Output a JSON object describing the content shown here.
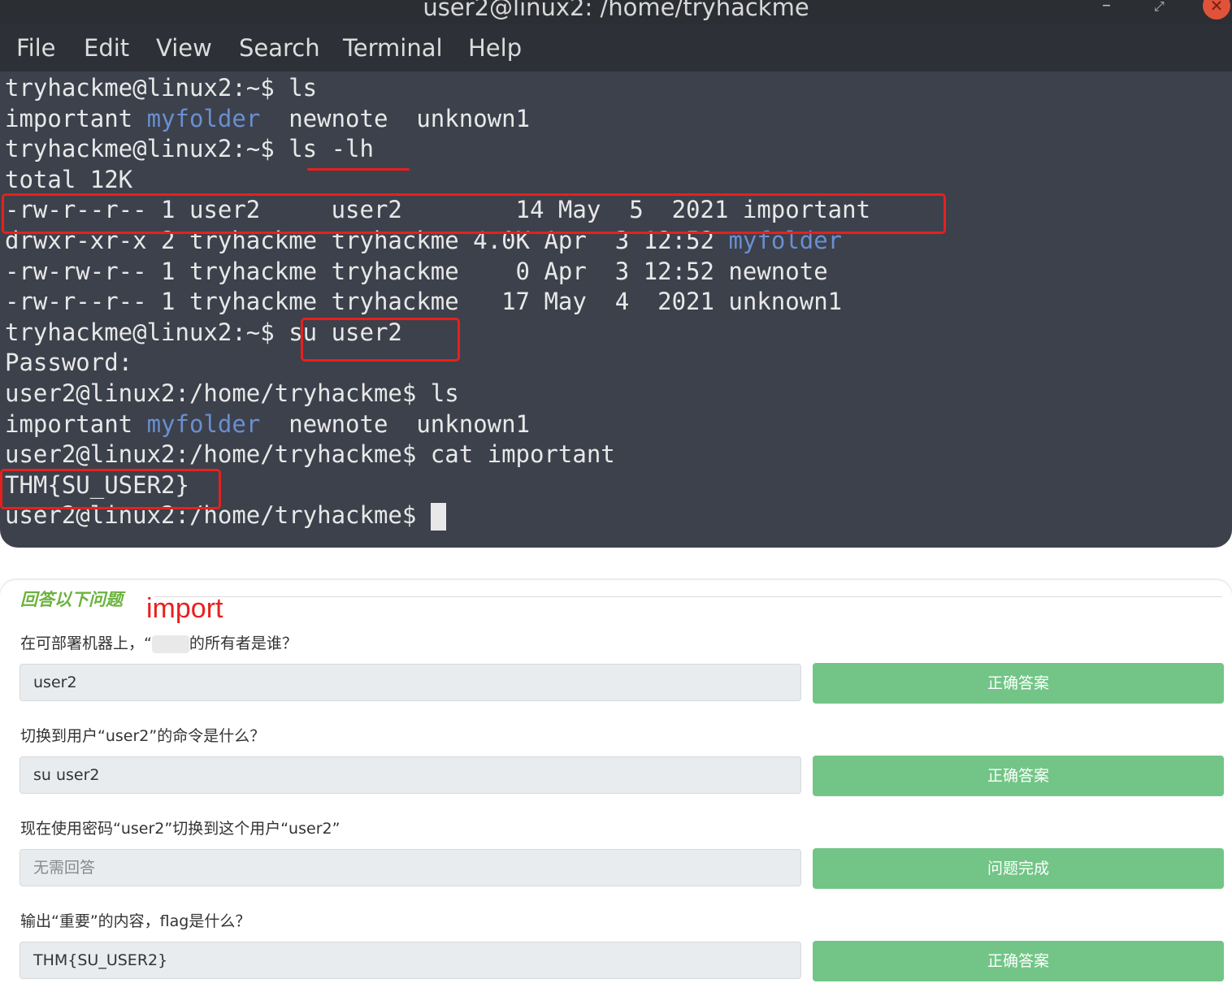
{
  "window": {
    "title": "user2@linux2: /home/tryhackme",
    "minimize_icon": "minimize-icon",
    "maximize_icon": "maximize-icon",
    "close_icon": "close-icon"
  },
  "menu": [
    "File",
    "Edit",
    "View",
    "Search",
    "Terminal",
    "Help"
  ],
  "terminal": {
    "lines": [
      "tryhackme@linux2:~$ ls",
      [
        "important ",
        "myfolder",
        "  newnote  unknown1"
      ],
      "tryhackme@linux2:~$ ls -lh",
      "total 12K",
      "-rw-r--r-- 1 user2     user2        14 May  5  2021 important",
      [
        "drwxr-xr-x 2 tryhackme tryhackme 4.0K Apr  3 12:52 ",
        "myfolder",
        ""
      ],
      "-rw-rw-r-- 1 tryhackme tryhackme    0 Apr  3 12:52 newnote",
      "-rw-r--r-- 1 tryhackme tryhackme   17 May  4  2021 unknown1",
      "tryhackme@linux2:~$ su user2",
      "Password:",
      "user2@linux2:/home/tryhackme$ ls",
      [
        "important ",
        "myfolder",
        "  newnote  unknown1"
      ],
      "user2@linux2:/home/tryhackme$ cat important",
      "THM{SU_USER2}",
      "user2@linux2:/home/tryhackme$ "
    ]
  },
  "questions_panel": {
    "title": "回答以下问题",
    "annotation": "import",
    "questions": [
      {
        "prefix": "在可部署机器上，“",
        "suffix": "的所有者是谁？",
        "answer": "user2",
        "placeholder": false,
        "button": "正确答案"
      },
      {
        "prefix": "切换到用户“user2”的命令是什么？",
        "suffix": "",
        "answer": "su user2",
        "placeholder": false,
        "button": "正确答案"
      },
      {
        "prefix": "现在使用密码“user2”切换到这个用户“user2”",
        "suffix": "",
        "answer": "无需回答",
        "placeholder": true,
        "button": "问题完成"
      },
      {
        "prefix": "输出“重要”的内容，flag是什么？",
        "suffix": "",
        "answer": "THM{SU_USER2}",
        "placeholder": false,
        "button": "正确答案"
      }
    ]
  },
  "colors": {
    "terminal_bg": "#3c414c",
    "directory_blue": "#6a8fd0",
    "annotation_red": "#e8201c",
    "button_green": "#72c586",
    "section_title_green": "#6cb33e"
  }
}
